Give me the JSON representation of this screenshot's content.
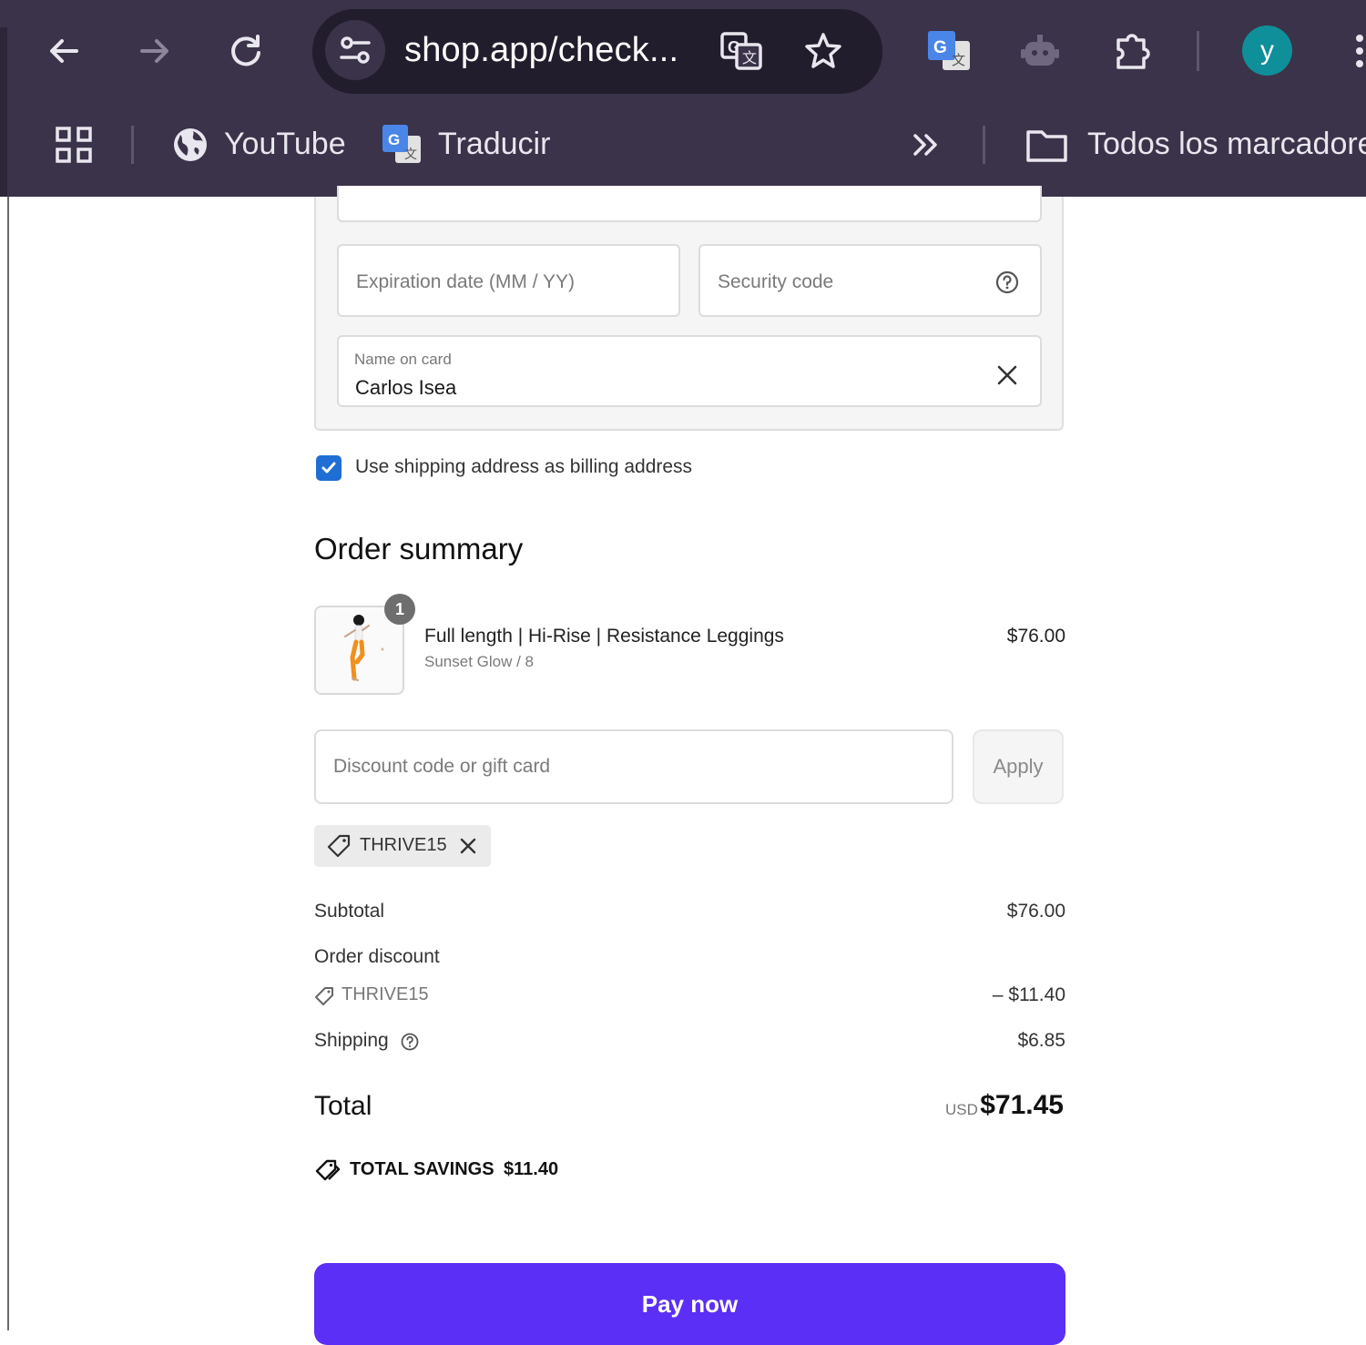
{
  "browser": {
    "url": "shop.app/check...",
    "avatar_letter": "y",
    "accent_color": "#0e8f9a",
    "bookmarks": [
      {
        "label": "YouTube",
        "icon": "globe-icon"
      },
      {
        "label": "Traducir",
        "icon": "google-translate-icon"
      }
    ],
    "all_bookmarks_label": "Todos los marcadore"
  },
  "payment": {
    "expiration_placeholder": "Expiration date (MM / YY)",
    "security_placeholder": "Security code",
    "name_label": "Name on card",
    "name_value": "Carlos Isea",
    "billing_checkbox_label": "Use shipping address as billing address",
    "billing_checked": true
  },
  "summary": {
    "title": "Order summary",
    "item": {
      "name": "Full length | Hi-Rise | Resistance Leggings",
      "variant": "Sunset Glow / 8",
      "price": "$76.00",
      "quantity": "1"
    },
    "discount_placeholder": "Discount code or gift card",
    "apply_label": "Apply",
    "applied_code": "THRIVE15",
    "subtotal_label": "Subtotal",
    "subtotal_value": "$76.00",
    "order_discount_label": "Order discount",
    "discount_code": "THRIVE15",
    "discount_value": "– $11.40",
    "shipping_label": "Shipping",
    "shipping_value": "$6.85",
    "total_label": "Total",
    "currency": "USD",
    "total_value": "$71.45",
    "savings_label": "TOTAL SAVINGS",
    "savings_value": "$11.40",
    "pay_label": "Pay now",
    "pay_color": "#5b2ff5"
  }
}
